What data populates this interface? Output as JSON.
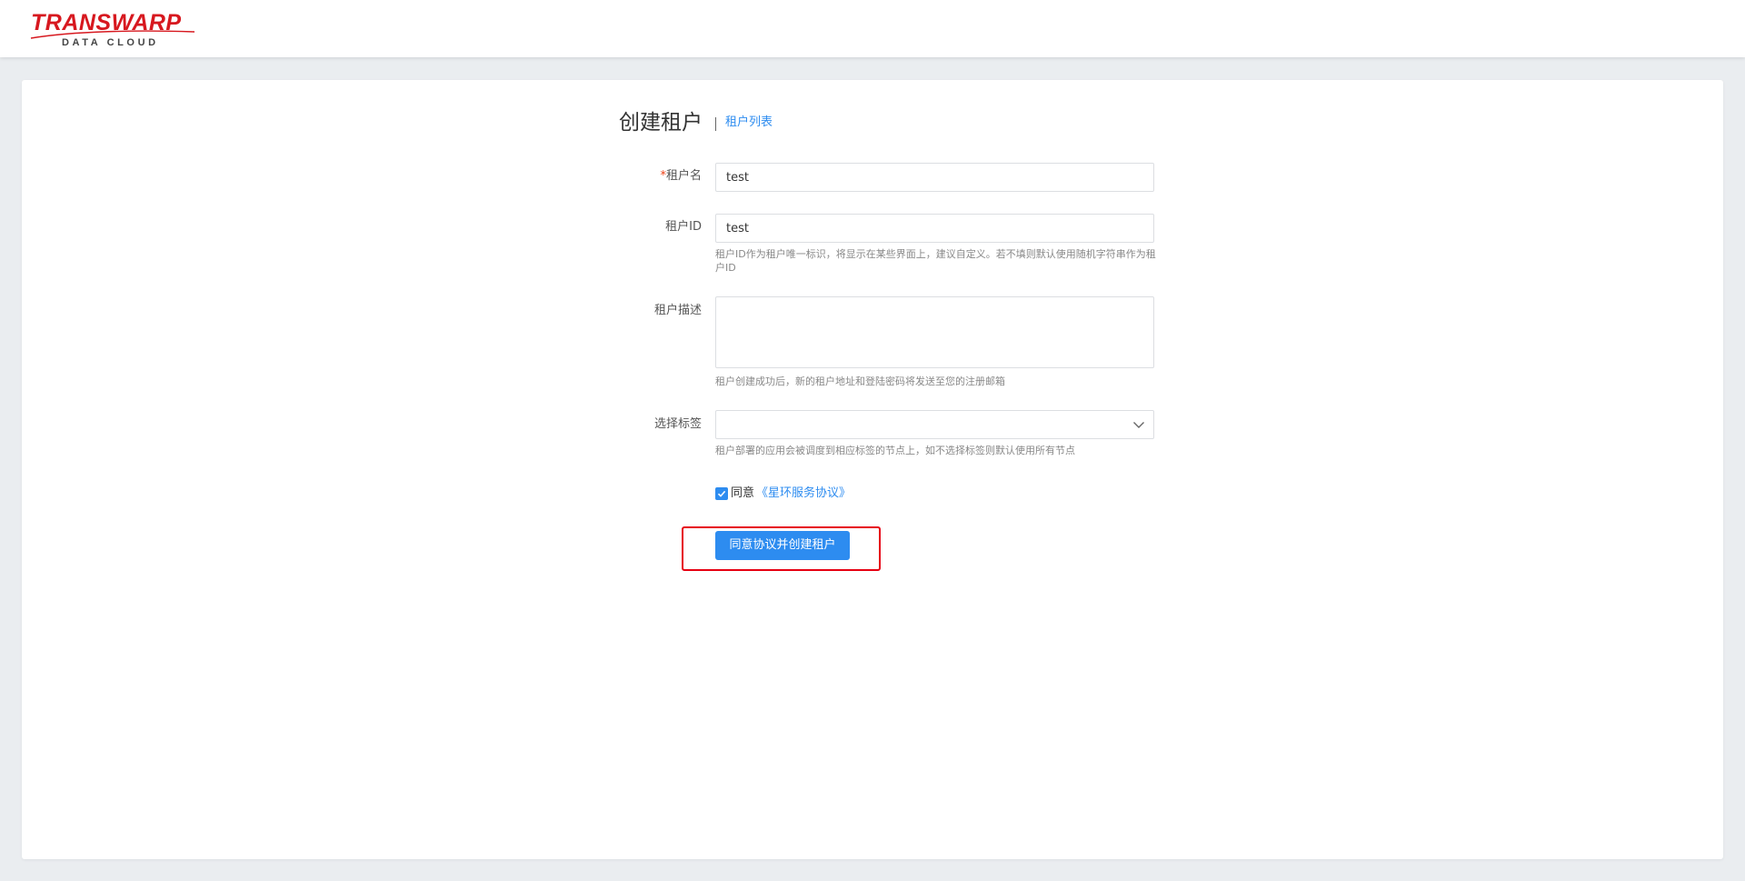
{
  "header": {
    "logo": {
      "main": "TRANSWARP",
      "sub": "DATA CLOUD"
    }
  },
  "page": {
    "title": "创建租户",
    "list_link": "租户列表"
  },
  "form": {
    "name": {
      "required_mark": "*",
      "label": "租户名",
      "value": "test"
    },
    "tenant_id": {
      "label": "租户ID",
      "value": "test",
      "hint": "租户ID作为租户唯一标识，将显示在某些界面上，建议自定义。若不填则默认使用随机字符串作为租户ID"
    },
    "description": {
      "label": "租户描述",
      "value": "",
      "hint": "租户创建成功后，新的租户地址和登陆密码将发送至您的注册邮箱"
    },
    "tags": {
      "label": "选择标签",
      "selected": "",
      "hint": "租户部署的应用会被调度到相应标签的节点上，如不选择标签则默认使用所有节点"
    },
    "agreement": {
      "checked": true,
      "prefix": "同意",
      "link_text": "《星环服务协议》"
    },
    "submit_label": "同意协议并创建租户"
  },
  "colors": {
    "primary": "#2d8cf0",
    "logo_red": "#d7181f",
    "highlight_red": "#e60012",
    "page_bg": "#eaedf0"
  }
}
